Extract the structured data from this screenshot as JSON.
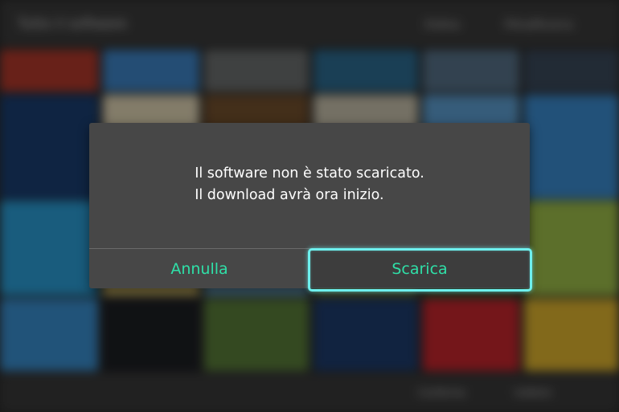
{
  "background": {
    "title": "Tutto il software",
    "top_actions": [
      "Ordina",
      "Filtra/Ricerca"
    ],
    "bottom_actions": [
      "Conferma",
      "Indietro"
    ]
  },
  "dialog": {
    "message_line1": "Il software non è stato scaricato.",
    "message_line2": "Il download avrà ora inizio.",
    "cancel_label": "Annulla",
    "download_label": "Scarica",
    "focused_button": "download"
  },
  "colors": {
    "dialog_bg": "#474747",
    "button_text": "#2fe0a8",
    "focus_ring": "#6ef0ee"
  }
}
